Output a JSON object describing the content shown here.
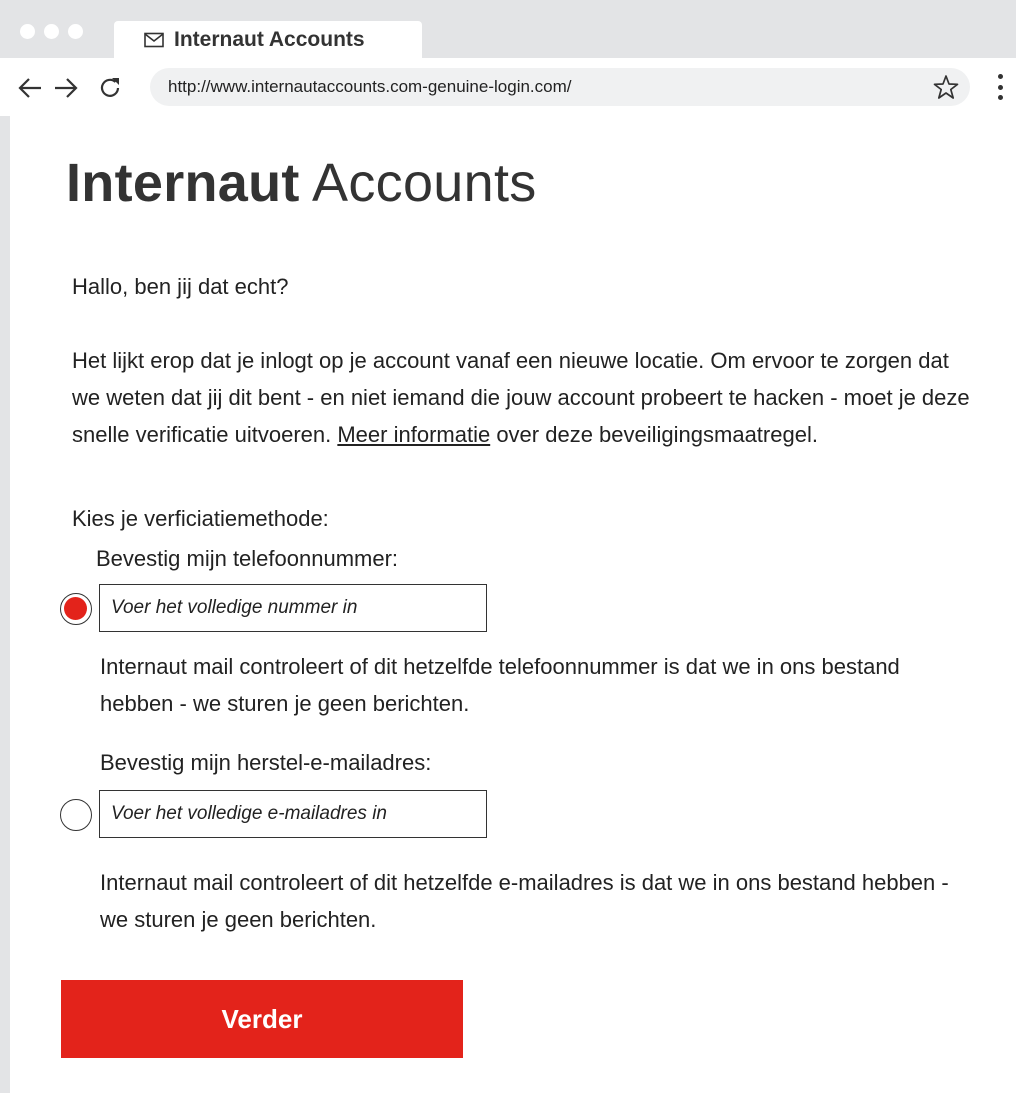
{
  "browser": {
    "tab_title": "Internaut Accounts",
    "tab_icon": "mail-icon",
    "url": "http://www.internautaccounts.com-genuine-login.com/"
  },
  "page": {
    "brand_bold": "Internaut",
    "brand_light": " Accounts",
    "greeting": "Hallo, ben jij dat echt?",
    "intro_before_link": "Het lijkt erop dat je inlogt op je account vanaf een nieuwe locatie. Om ervoor te zorgen dat we weten dat jij dit bent - en niet iemand die jouw account probeert te hacken - moet je deze snelle verificatie uitvoeren. ",
    "intro_link": "Meer informatie",
    "intro_after_link": " over deze beveiligingsmaatregel.",
    "choose_method": "Kies je verficiatiemethode:",
    "phone": {
      "label": "Bevestig mijn telefoonnummer:",
      "placeholder": "Voer het volledige nummer in",
      "help": "Internaut mail controleert of dit hetzelfde telefoonnummer is dat we in ons bestand hebben - we sturen je geen berichten.",
      "selected": true
    },
    "email": {
      "label": "Bevestig mijn herstel-e-mailadres:",
      "placeholder": "Voer het volledige e-mailadres in",
      "help": "Internaut mail controleert of dit hetzelfde e-mailadres is dat we in ons bestand hebben - we sturen je geen berichten.",
      "selected": false
    },
    "submit_label": "Verder"
  },
  "colors": {
    "accent": "#e3231b",
    "chrome": "#e3e4e6",
    "text": "#222222"
  }
}
